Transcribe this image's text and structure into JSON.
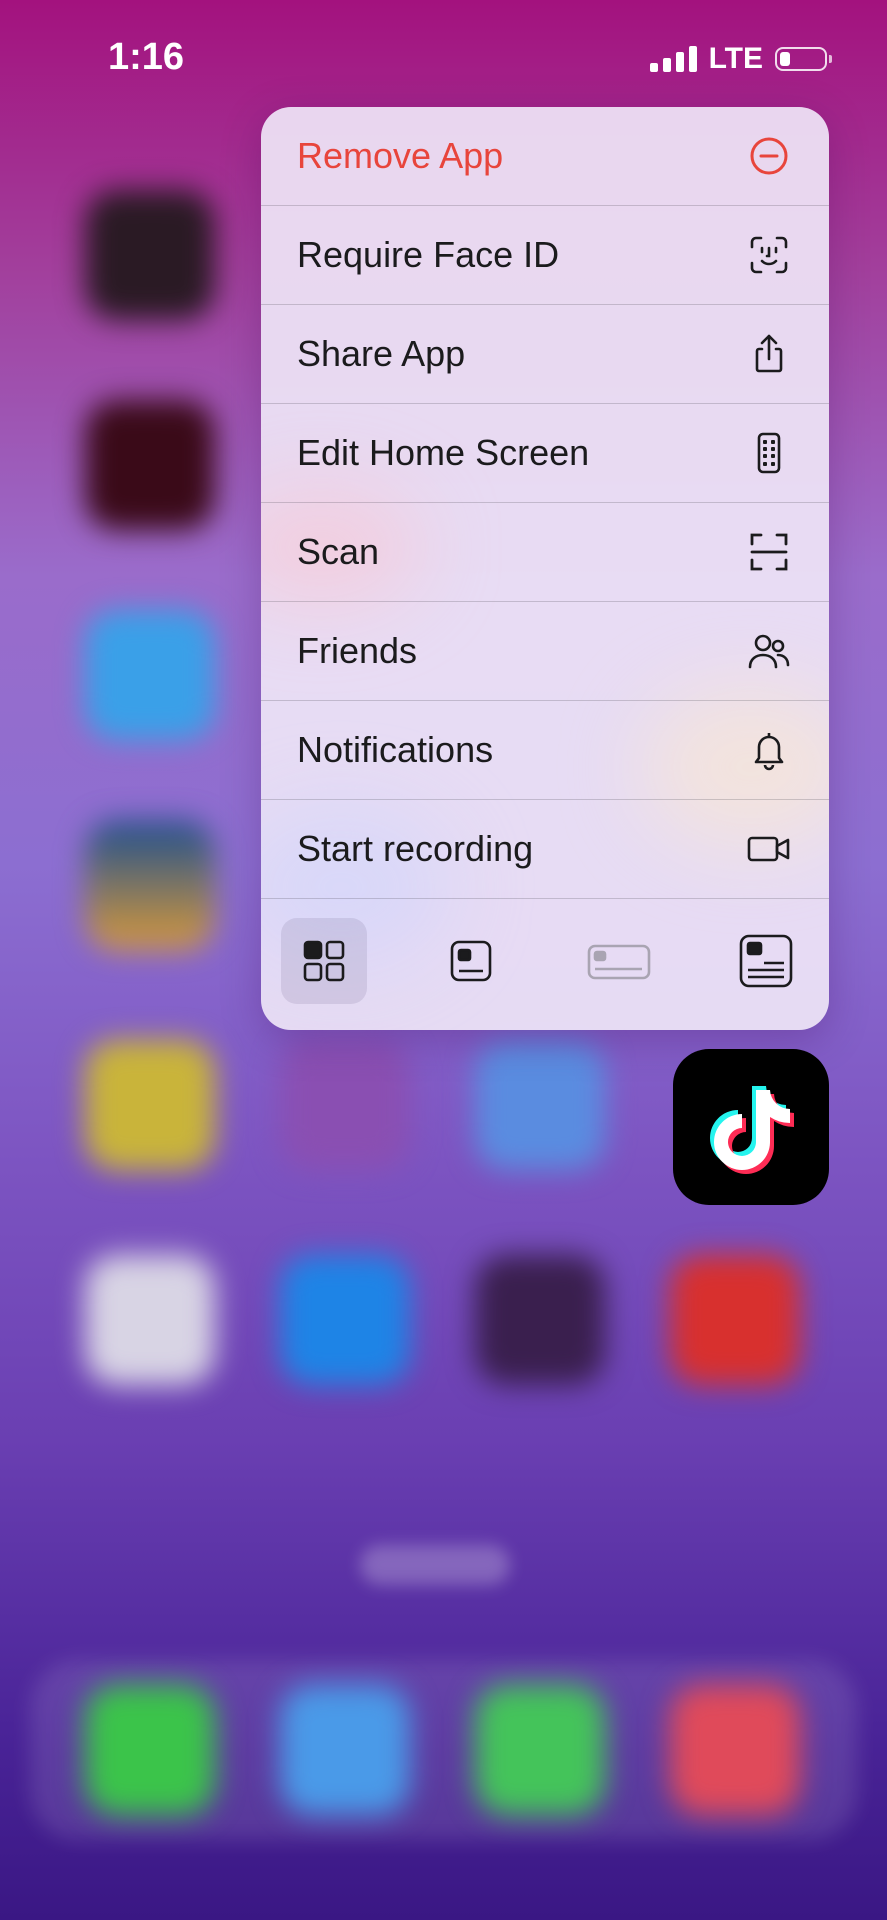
{
  "status_bar": {
    "time": "1:16",
    "network": "LTE"
  },
  "menu": {
    "items": [
      {
        "label": "Remove App",
        "icon": "minus-circle-icon",
        "danger": true
      },
      {
        "label": "Require Face ID",
        "icon": "face-id-icon"
      },
      {
        "label": "Share App",
        "icon": "share-icon"
      },
      {
        "label": "Edit Home Screen",
        "icon": "phone-apps-icon"
      },
      {
        "label": "Scan",
        "icon": "scan-frame-icon"
      },
      {
        "label": "Friends",
        "icon": "friends-icon"
      },
      {
        "label": "Notifications",
        "icon": "bell-icon"
      },
      {
        "label": "Start recording",
        "icon": "video-camera-icon"
      }
    ],
    "widget_sizes": [
      "small-grid",
      "small",
      "medium",
      "large"
    ],
    "selected_size": "small-grid"
  },
  "app": {
    "name": "TikTok",
    "icon": "tiktok-icon"
  },
  "colors": {
    "danger": "#e8453c",
    "accent_bg_top": "#a3127e",
    "accent_bg_bottom": "#3a1784"
  }
}
